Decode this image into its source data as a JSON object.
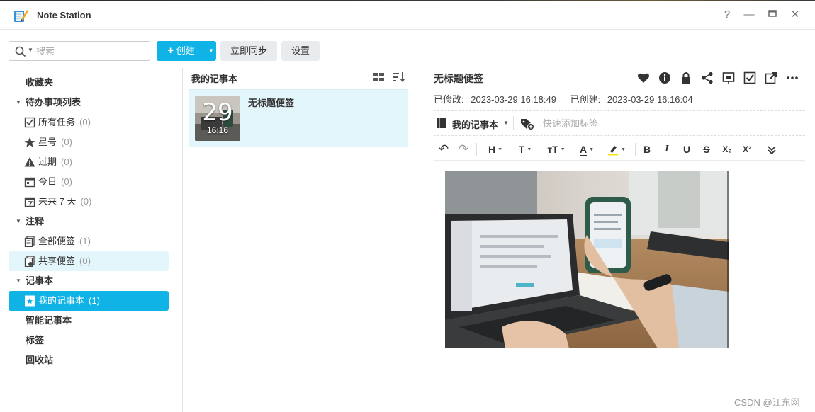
{
  "app": {
    "title": "Note Station"
  },
  "window_controls": {
    "help": "?",
    "minimize": "—",
    "maximize": "▭",
    "close": "✕"
  },
  "toolbar": {
    "search_placeholder": "搜索",
    "create_label": "创建",
    "sync_label": "立即同步",
    "settings_label": "设置"
  },
  "sidebar": {
    "favorites": "收藏夹",
    "todo_section": "待办事项列表",
    "todo_items": [
      {
        "label": "所有任务",
        "count": "(0)"
      },
      {
        "label": "星号",
        "count": "(0)"
      },
      {
        "label": "过期",
        "count": "(0)"
      },
      {
        "label": "今日",
        "count": "(0)"
      },
      {
        "label": "未来 7 天",
        "count": "(0)"
      }
    ],
    "notes_section": "注释",
    "notes_items": [
      {
        "label": "全部便签",
        "count": "(1)"
      },
      {
        "label": "共享便签",
        "count": "(0)"
      }
    ],
    "notebooks_section": "记事本",
    "notebook_items": [
      {
        "label": "我的记事本",
        "count": "(1)"
      }
    ],
    "smart_notebooks": "智能记事本",
    "tags": "标签",
    "trash": "回收站"
  },
  "note_list": {
    "title": "我的记事本",
    "items": [
      {
        "title": "无标题便签",
        "day": "29",
        "time": "16:16"
      }
    ]
  },
  "note": {
    "title": "无标题便签",
    "modified_label": "已修改:",
    "modified_value": "2023-03-29 16:18:49",
    "created_label": "已创建:",
    "created_value": "2023-03-29 16:16:04",
    "notebook": "我的记事本",
    "tag_placeholder": "快速添加标签"
  },
  "format_toolbar": {
    "undo": "↶",
    "redo": "↷",
    "heading": "H",
    "font": "T",
    "size": "тT",
    "color": "A",
    "bold": "B",
    "italic": "I",
    "underline": "U",
    "strike": "S",
    "subscript": "X₂",
    "superscript": "X²",
    "more": "≚"
  },
  "colors": {
    "accent": "#0fb3e5",
    "selected_bg": "#e3f6fb"
  },
  "watermark": "CSDN @江东网"
}
